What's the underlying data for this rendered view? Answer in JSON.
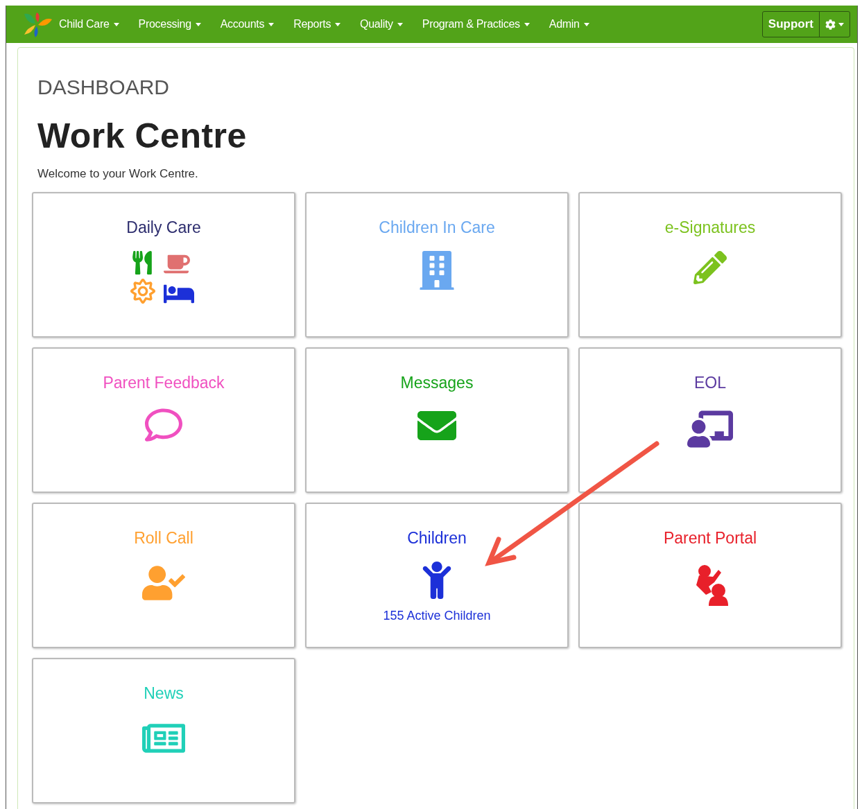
{
  "nav": {
    "items": [
      {
        "label": "Child Care"
      },
      {
        "label": "Processing"
      },
      {
        "label": "Accounts"
      },
      {
        "label": "Reports"
      },
      {
        "label": "Quality"
      },
      {
        "label": "Program & Practices"
      },
      {
        "label": "Admin"
      }
    ],
    "support": "Support"
  },
  "page": {
    "breadcrumb": "DASHBOARD",
    "title": "Work Centre",
    "welcome": "Welcome to your Work Centre."
  },
  "tiles": [
    {
      "title": "Daily Care",
      "color": "#2d2d6e",
      "kind": "daily"
    },
    {
      "title": "Children In Care",
      "color": "#6aa8f0",
      "kind": "building"
    },
    {
      "title": "e-Signatures",
      "color": "#7cc21e",
      "kind": "pencil"
    },
    {
      "title": "Parent Feedback",
      "color": "#f050c0",
      "kind": "comment"
    },
    {
      "title": "Messages",
      "color": "#16a31a",
      "kind": "envelope"
    },
    {
      "title": "EOL",
      "color": "#5b3aa0",
      "kind": "teacher"
    },
    {
      "title": "Roll Call",
      "color": "#ffa030",
      "kind": "usercheck"
    },
    {
      "title": "Children",
      "color": "#1c30d8",
      "kind": "child",
      "subtitle": "155 Active Children"
    },
    {
      "title": "Parent Portal",
      "color": "#e8202a",
      "kind": "parent"
    },
    {
      "title": "News",
      "color": "#20d0b8",
      "kind": "news"
    }
  ]
}
